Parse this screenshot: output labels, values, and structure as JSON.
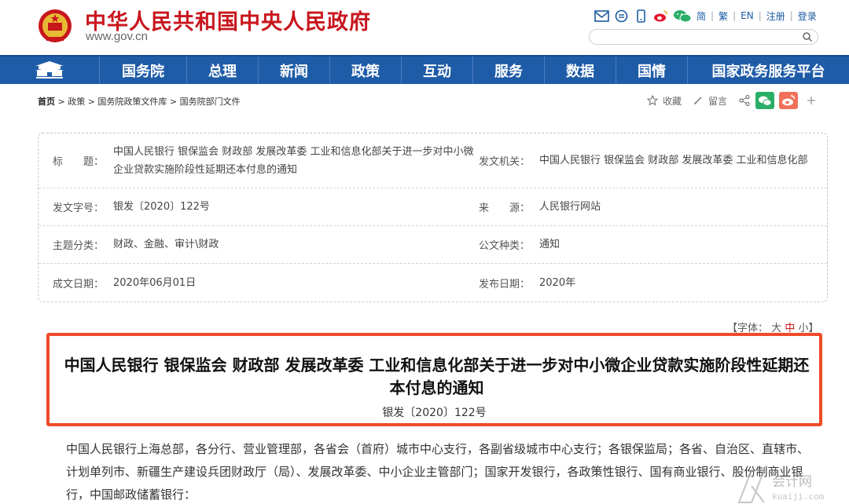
{
  "header": {
    "site_title": "中华人民共和国中央人民政府",
    "site_url": "www.gov.cn",
    "top_links": {
      "simplified": "简",
      "sep": "|",
      "traditional": "繁",
      "english": "EN",
      "register": "注册",
      "login": "登录"
    },
    "search_placeholder": ""
  },
  "nav": {
    "items": [
      "国务院",
      "总理",
      "新闻",
      "政策",
      "互动",
      "服务",
      "数据",
      "国情",
      "国家政务服务平台"
    ]
  },
  "breadcrumb": {
    "home": "首页",
    "path": " > 政策 > 国务院政策文件库 > 国务院部门文件"
  },
  "tools": {
    "favorite": "收藏",
    "comment": "留言"
  },
  "info": {
    "title_label": "标　　题：",
    "title_value": "中国人民银行 银保监会 财政部 发展改革委 工业和信息化部关于进一步对中小微企业贷款实施阶段性延期还本付息的通知",
    "issuer_label": "发文机关：",
    "issuer_value": "中国人民银行 银保监会 财政部 发展改革委 工业和信息化部",
    "docno_label": "发文字号：",
    "docno_value": "银发〔2020〕122号",
    "source_label": "来　　源：",
    "source_value": "人民银行网站",
    "topic_label": "主题分类：",
    "topic_value": "财政、金融、审计\\财政",
    "type_label": "公文种类：",
    "type_value": "通知",
    "date_label": "成文日期：",
    "date_value": "2020年06月01日",
    "pub_label": "发布日期：",
    "pub_value": "2020年"
  },
  "font_size": {
    "prefix": "【字体：",
    "large": "大",
    "medium": "中",
    "small": "小",
    "suffix": "】"
  },
  "document": {
    "title": "中国人民银行 银保监会 财政部 发展改革委 工业和信息化部关于进一步对中小微企业贷款实施阶段性延期还本付息的通知",
    "doc_no": "银发〔2020〕122号",
    "body": "中国人民银行上海总部，各分行、营业管理部，各省会（首府）城市中心支行，各副省级城市中心支行；各银保监局；各省、自治区、直辖市、计划单列市、新疆生产建设兵团财政厅（局）、发展改革委、中小企业主管部门；国家开发银行，各政策性银行、国有商业银行、股份制商业银行，中国邮政储蓄银行："
  },
  "watermark": {
    "text_cn": "会计网",
    "text_en": "kuaiji.com"
  },
  "colors": {
    "brand_red": "#c8161d",
    "nav_blue": "#1f5ca8",
    "highlight": "#ef4a29"
  }
}
